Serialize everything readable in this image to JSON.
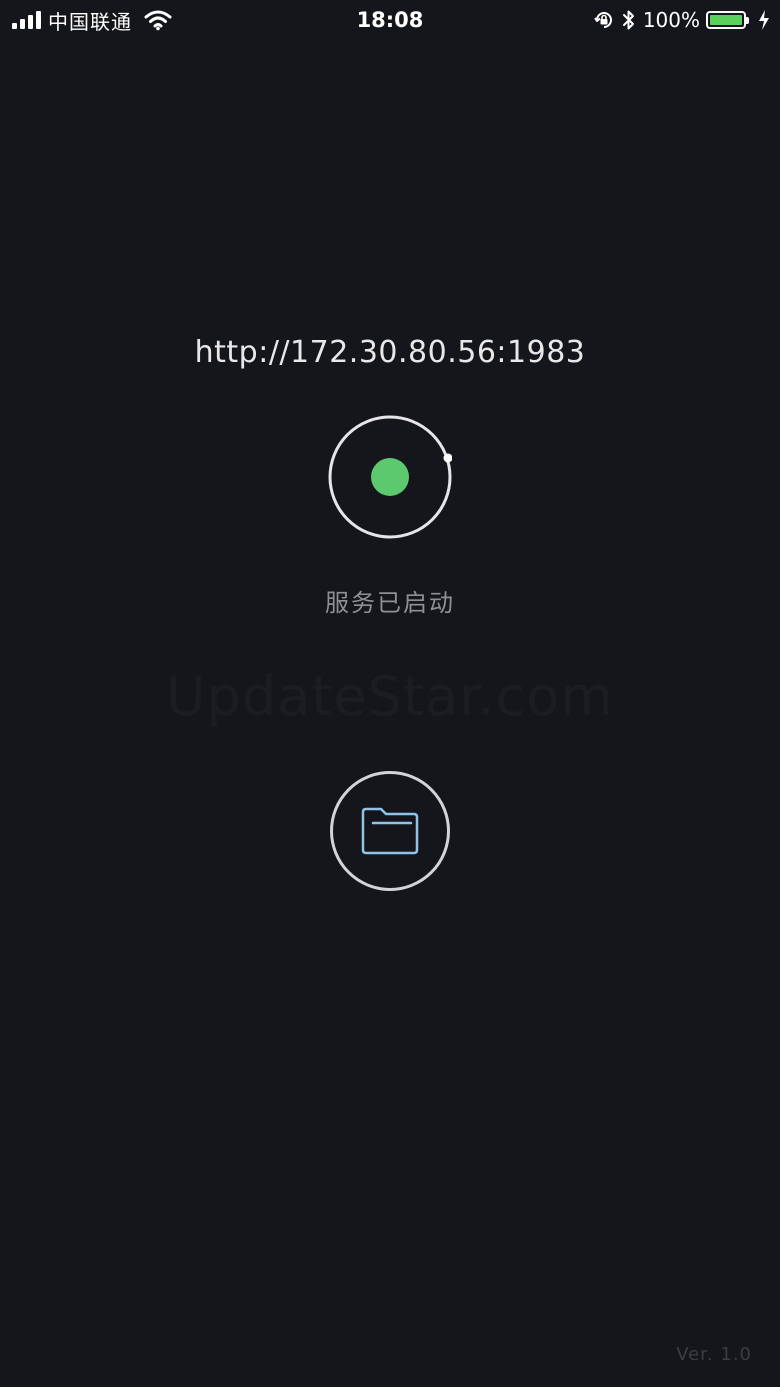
{
  "status_bar": {
    "carrier": "中国联通",
    "time": "18:08",
    "battery_percent": "100%",
    "battery_level": 1.0,
    "icons": [
      "signal-icon",
      "wifi-icon",
      "rotation-lock-icon",
      "bluetooth-icon",
      "battery-icon",
      "charging-icon"
    ]
  },
  "server": {
    "url": "http://172.30.80.56:1983",
    "status_text": "服务已启动",
    "status_color": "#5cc96e"
  },
  "watermark": "UpdateStar.com",
  "folder_button": {
    "icon": "folder-icon",
    "icon_color": "#8fc3ea"
  },
  "footer": {
    "version": "Ver. 1.0"
  }
}
